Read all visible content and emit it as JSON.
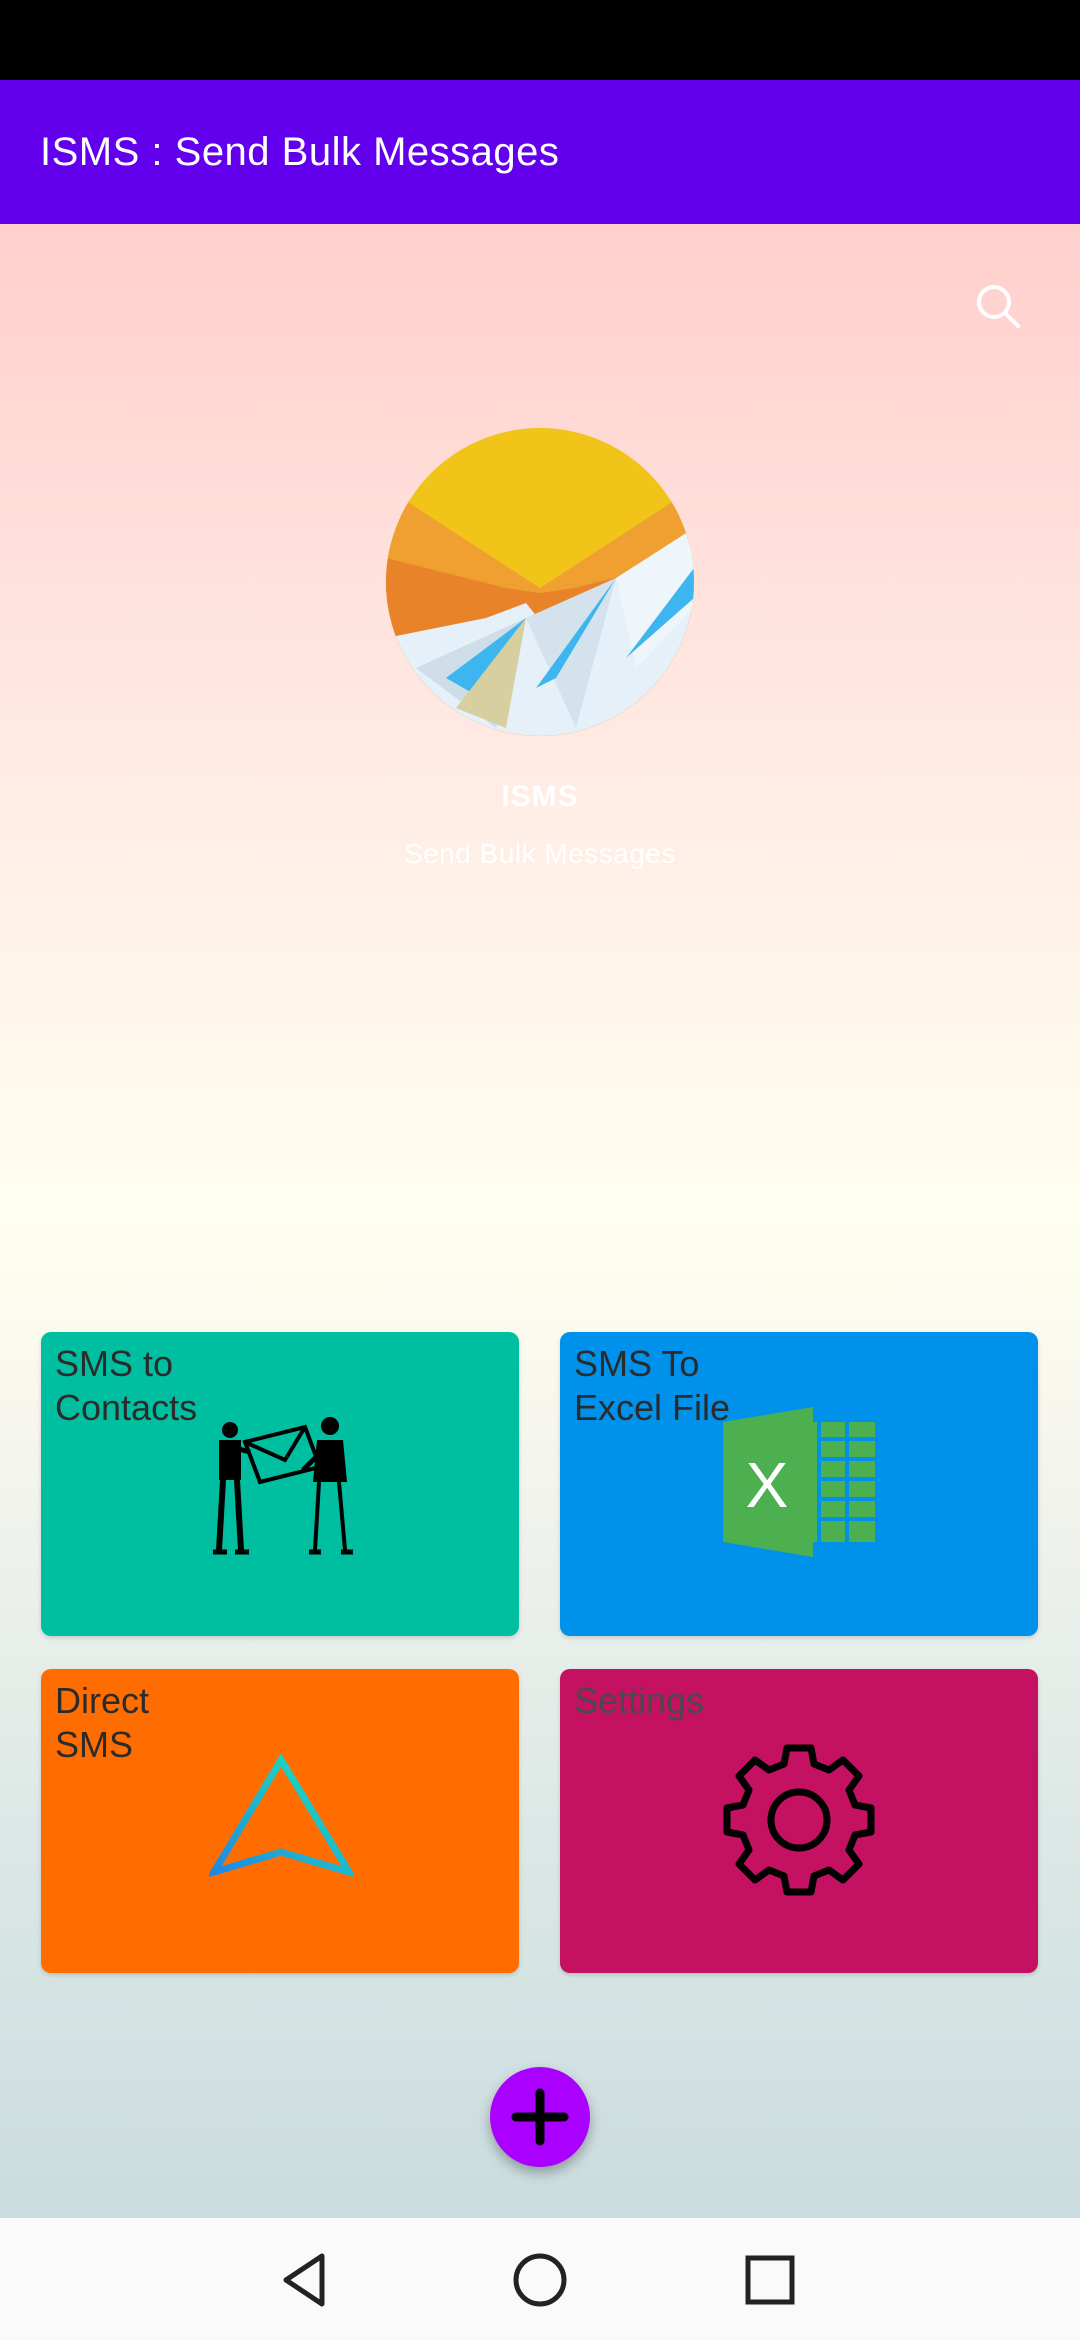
{
  "app_bar": {
    "title": "ISMS : Send Bulk Messages"
  },
  "header": {
    "brand_name": "ISMS",
    "brand_subtitle": "Send Bulk Messages"
  },
  "tiles": [
    {
      "label": "SMS to\nContacts",
      "color": "#00BFA0",
      "icon": "people-carrying-envelope-icon"
    },
    {
      "label": "SMS To\nExcel File",
      "color": "#0091EA",
      "icon": "excel-icon"
    },
    {
      "label": "Direct\nSMS",
      "color": "#FF6D00",
      "icon": "send-arrow-icon"
    },
    {
      "label": "Settings",
      "color": "#C51162",
      "icon": "gear-icon"
    }
  ],
  "icons": {
    "search": "search-icon",
    "fab": "plus-icon"
  },
  "colors": {
    "primary": "#6200EE",
    "fab": "#AA00FF"
  }
}
